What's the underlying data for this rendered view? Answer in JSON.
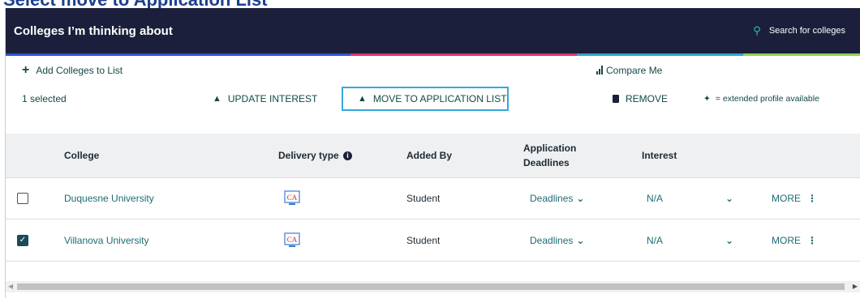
{
  "page": {
    "cutoff_title": "Select move to Application List"
  },
  "header": {
    "title": "Colleges I’m thinking about",
    "search_label": "Search for colleges"
  },
  "stripes": [
    "#2f55d4",
    "#2f55d4",
    "#e0306c",
    "#e0306c",
    "#2ba8c9",
    "#8fd14f"
  ],
  "actions": {
    "add_label": "Add Colleges to List",
    "compare_label": "Compare Me",
    "selected_count": "1 selected",
    "update_interest": "UPDATE INTEREST",
    "move_to_app": "MOVE TO APPLICATION LIST",
    "remove": "REMOVE",
    "extended_note": "= extended profile available"
  },
  "table": {
    "columns": {
      "college": "College",
      "delivery": "Delivery type",
      "added_by": "Added By",
      "deadlines_line1": "Application",
      "deadlines_line2": "Deadlines",
      "interest": "Interest"
    },
    "rows": [
      {
        "checked": false,
        "college": "Duquesne University",
        "delivery": "CA",
        "added_by": "Student",
        "deadlines": "Deadlines",
        "interest": "N/A",
        "more": "MORE"
      },
      {
        "checked": true,
        "college": "Villanova University",
        "delivery": "CA",
        "added_by": "Student",
        "deadlines": "Deadlines",
        "interest": "N/A",
        "more": "MORE"
      }
    ]
  },
  "colors": {
    "header_bg": "#1c1f3b",
    "accent_teal": "#1d6c73",
    "highlight_border": "#36a8de"
  }
}
